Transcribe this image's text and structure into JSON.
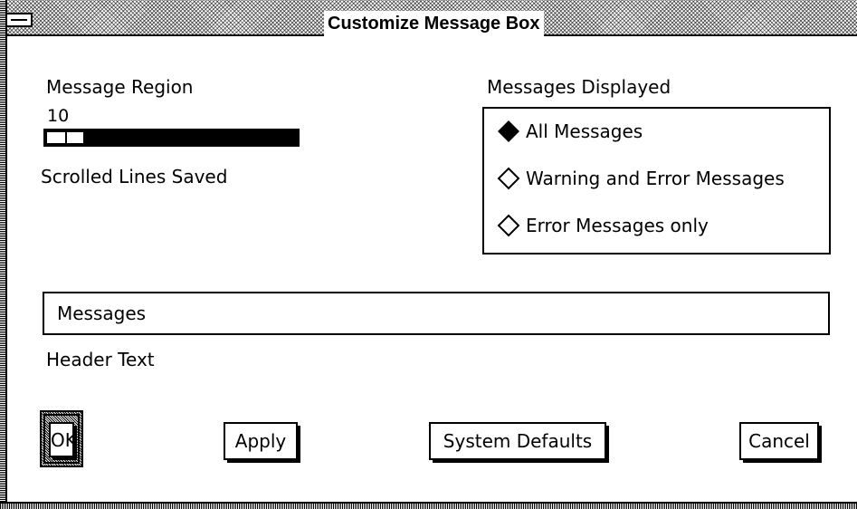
{
  "window": {
    "title": "Customize Message Box"
  },
  "message_region": {
    "label": "Message Region",
    "value": "10",
    "fraction": 0.14,
    "caption": "Scrolled Lines Saved"
  },
  "messages_displayed": {
    "label": "Messages Displayed",
    "options": [
      {
        "label": "All Messages",
        "selected": true
      },
      {
        "label": "Warning and Error Messages",
        "selected": false
      },
      {
        "label": "Error Messages only",
        "selected": false
      }
    ]
  },
  "header_text": {
    "value": "Messages",
    "label": "Header Text"
  },
  "buttons": {
    "ok": "OK",
    "apply": "Apply",
    "defaults": "System Defaults",
    "cancel": "Cancel"
  },
  "icons": {
    "window_menu": "window-menu-icon",
    "selected": "diamond-filled-icon",
    "unselected": "diamond-outline-icon"
  }
}
